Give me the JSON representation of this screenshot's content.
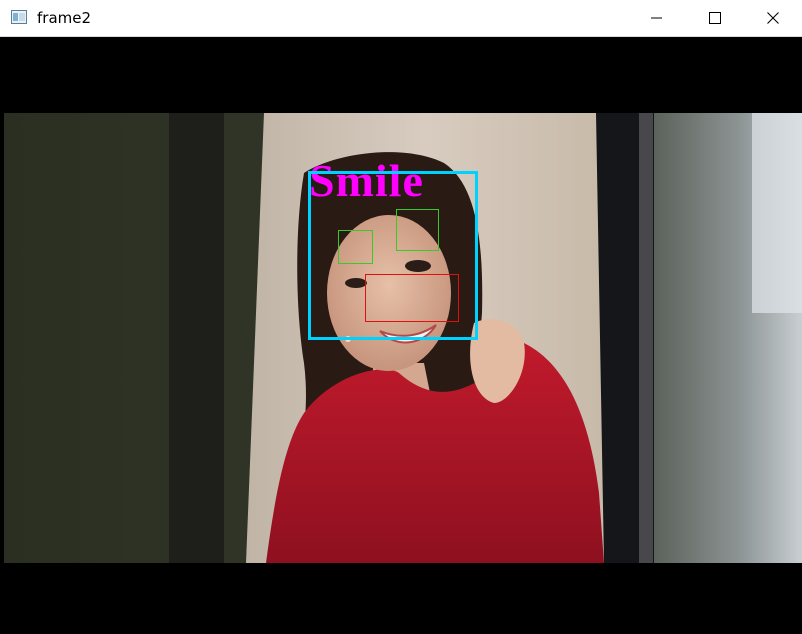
{
  "window": {
    "title": "frame2",
    "icon": "opencv-window-icon",
    "controls": {
      "minimize": "minimize-icon",
      "maximize": "maximize-icon",
      "close": "close-icon"
    }
  },
  "overlay": {
    "label": "Smile",
    "label_color": "#ff00ff",
    "detections": [
      {
        "kind": "face",
        "color": "#00d2ff"
      },
      {
        "kind": "eye",
        "color": "#3cc828"
      },
      {
        "kind": "eye",
        "color": "#3cc828"
      },
      {
        "kind": "smile",
        "color": "#e01010"
      }
    ]
  }
}
